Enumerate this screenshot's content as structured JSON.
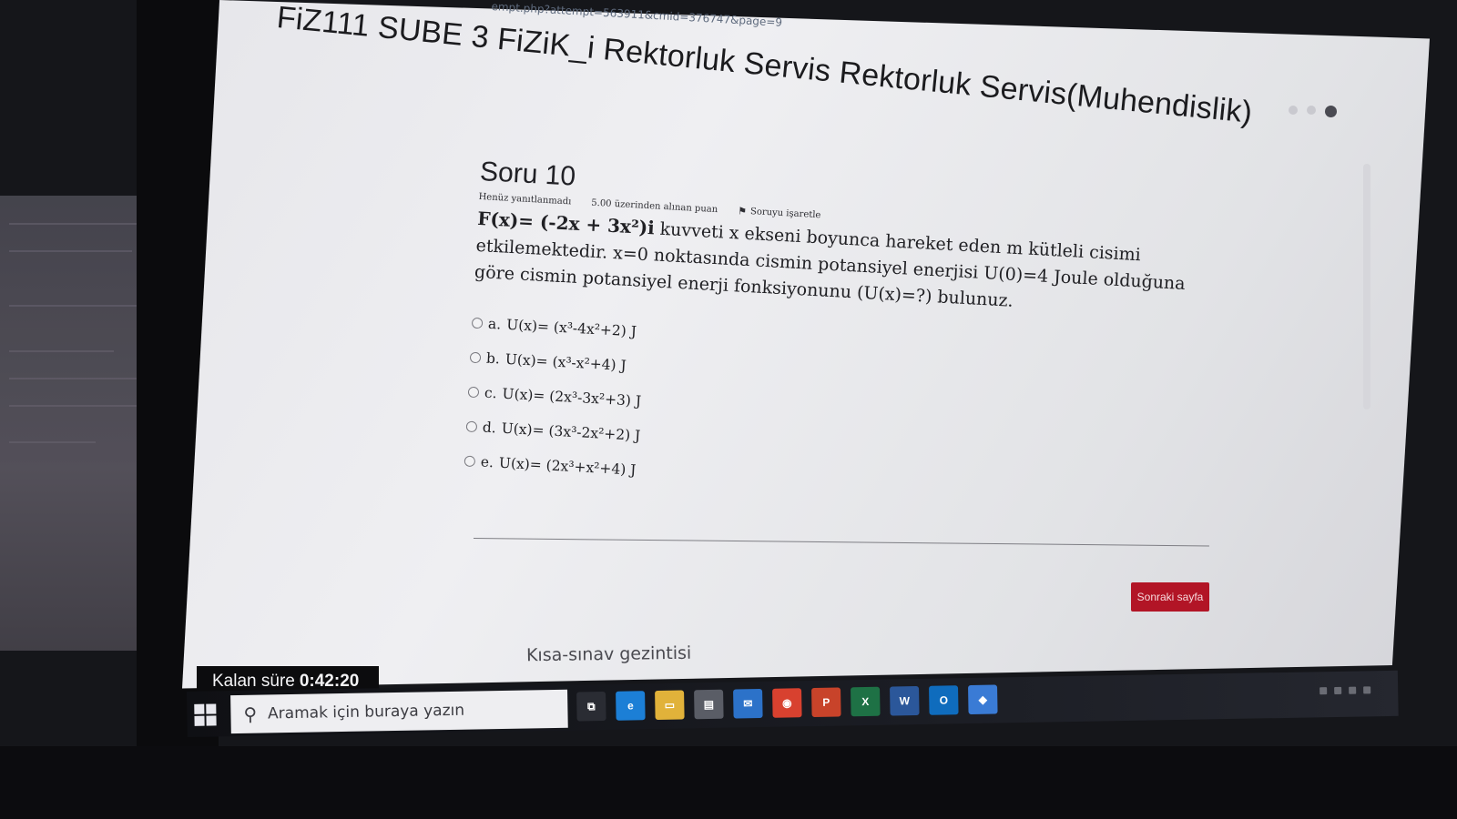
{
  "browser": {
    "url_fragment": "empt.php?attempt=563911&cmid=376747&page=9"
  },
  "course": {
    "title": "FiZ111 SUBE 3 FiZiK_i Rektorluk Servis Rektorluk Servis(Muhendislik)"
  },
  "question": {
    "heading": "Soru 10",
    "status": "Henüz yanıtlanmadı",
    "points": "5.00 üzerinden alınan puan",
    "flag_label": "Soruyu işaretle",
    "force_label": "F(x)= (-2x + 3x²)i",
    "text": "kuvveti x ekseni boyunca hareket eden m kütleli cisimi etkilemektedir. x=0 noktasında cismin potansiyel enerjisi U(0)=4 Joule olduğuna göre cismin potansiyel enerji fonksiyonunu (U(x)=?) bulunuz.",
    "options": [
      {
        "letter": "a.",
        "text": "U(x)= (x³-4x²+2) J"
      },
      {
        "letter": "b.",
        "text": "U(x)= (x³-x²+4) J"
      },
      {
        "letter": "c.",
        "text": "U(x)= (2x³-3x²+3) J"
      },
      {
        "letter": "d.",
        "text": "U(x)= (3x³-2x²+2) J"
      },
      {
        "letter": "e.",
        "text": "U(x)= (2x³+x²+4) J"
      }
    ]
  },
  "navigation": {
    "next_button": "Sonraki sayfa",
    "quiz_nav_link": "Kısa-sınav gezintisi"
  },
  "timer": {
    "label": "Kalan süre",
    "value": "0:42:20"
  },
  "taskbar": {
    "search_placeholder": "Aramak için buraya yazın",
    "apps": [
      {
        "name": "task-view",
        "glyph": "⧉",
        "color": "#2a2c33"
      },
      {
        "name": "edge",
        "glyph": "e",
        "color": "#1c7fd6"
      },
      {
        "name": "file-explorer",
        "glyph": "▭",
        "color": "#e1b23a"
      },
      {
        "name": "store",
        "glyph": "▤",
        "color": "#5a5d66"
      },
      {
        "name": "mail",
        "glyph": "✉",
        "color": "#2c72c9"
      },
      {
        "name": "chrome",
        "glyph": "◉",
        "color": "#d8412f"
      },
      {
        "name": "powerpoint",
        "glyph": "P",
        "color": "#c8432a"
      },
      {
        "name": "excel",
        "glyph": "X",
        "color": "#1e7145"
      },
      {
        "name": "word",
        "glyph": "W",
        "color": "#2b579a"
      },
      {
        "name": "outlook",
        "glyph": "O",
        "color": "#0f6cbd"
      },
      {
        "name": "extra-app",
        "glyph": "◆",
        "color": "#3a7bd5"
      }
    ]
  },
  "colors": {
    "accent_button": "#b21526",
    "timer_bg": "#0c0c0e"
  }
}
